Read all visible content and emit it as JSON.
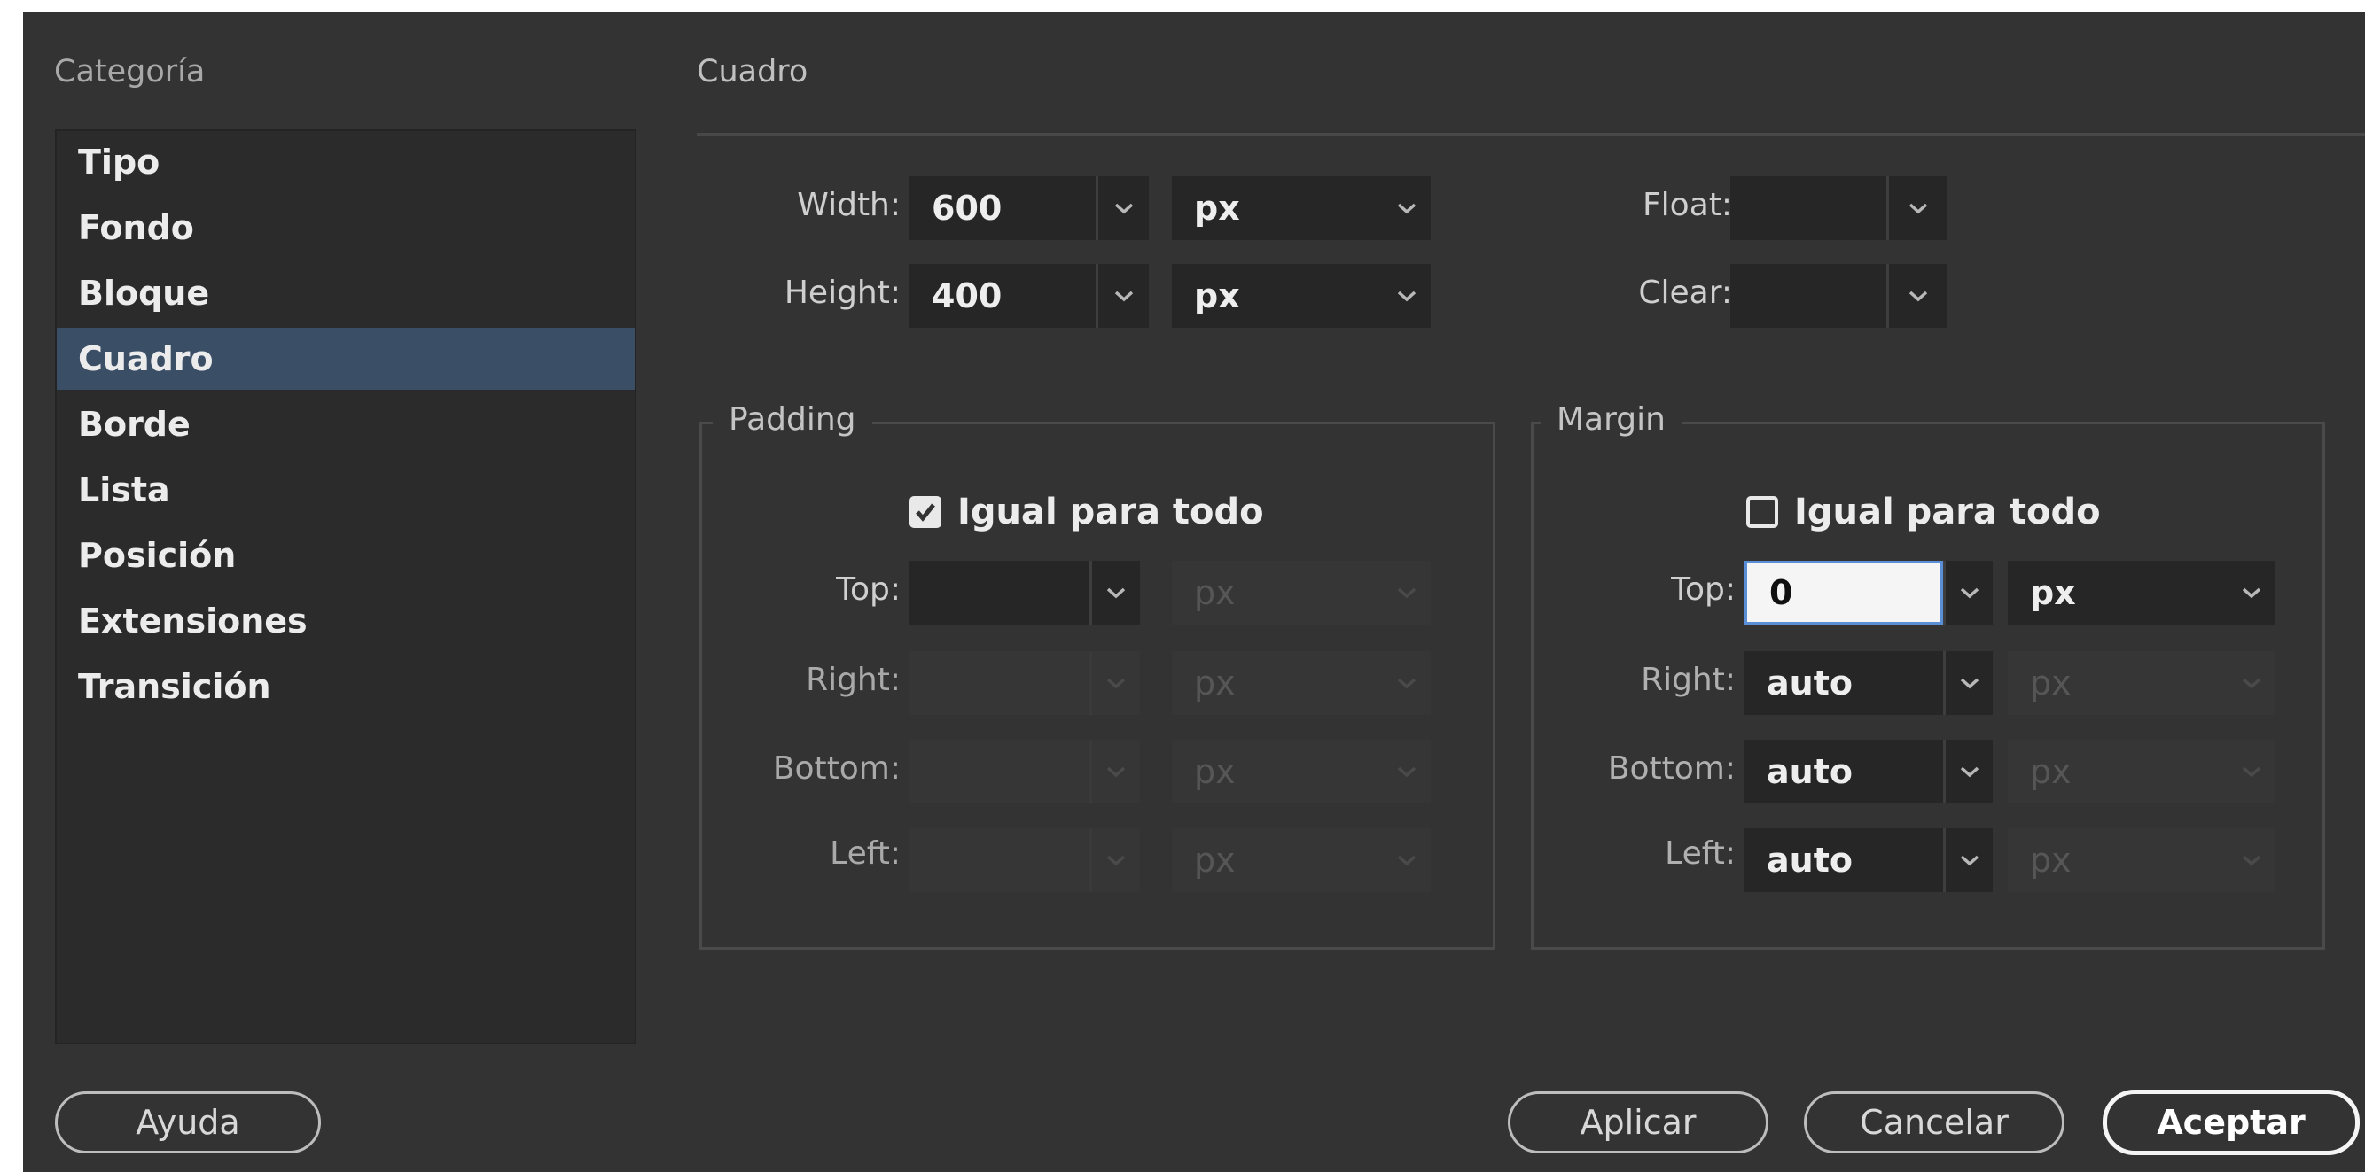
{
  "sidebar": {
    "title": "Categoría",
    "items": [
      "Tipo",
      "Fondo",
      "Bloque",
      "Cuadro",
      "Borde",
      "Lista",
      "Posición",
      "Extensiones",
      "Transición"
    ],
    "selected": "Cuadro"
  },
  "section_title": "Cuadro",
  "box": {
    "width": {
      "label": "Width:",
      "value": "600",
      "unit": "px"
    },
    "height": {
      "label": "Height:",
      "value": "400",
      "unit": "px"
    },
    "float": {
      "label": "Float:",
      "value": ""
    },
    "clear": {
      "label": "Clear:",
      "value": ""
    }
  },
  "padding": {
    "legend": "Padding",
    "same_for_all": {
      "label": "Igual para todo",
      "checked": true
    },
    "top": {
      "label": "Top:",
      "value": "",
      "unit": "px"
    },
    "right": {
      "label": "Right:",
      "value": "",
      "unit": "px"
    },
    "bottom": {
      "label": "Bottom:",
      "value": "",
      "unit": "px"
    },
    "left": {
      "label": "Left:",
      "value": "",
      "unit": "px"
    }
  },
  "margin": {
    "legend": "Margin",
    "same_for_all": {
      "label": "Igual para todo",
      "checked": false
    },
    "top": {
      "label": "Top:",
      "value": "0",
      "unit": "px"
    },
    "right": {
      "label": "Right:",
      "value": "auto",
      "unit": "px"
    },
    "bottom": {
      "label": "Bottom:",
      "value": "auto",
      "unit": "px"
    },
    "left": {
      "label": "Left:",
      "value": "auto",
      "unit": "px"
    }
  },
  "buttons": {
    "help": "Ayuda",
    "apply": "Aplicar",
    "cancel": "Cancelar",
    "ok": "Aceptar"
  },
  "colors": {
    "dialog_bg": "#333333",
    "selection": "#3a4e66",
    "focus_ring": "#5a8fd8"
  }
}
